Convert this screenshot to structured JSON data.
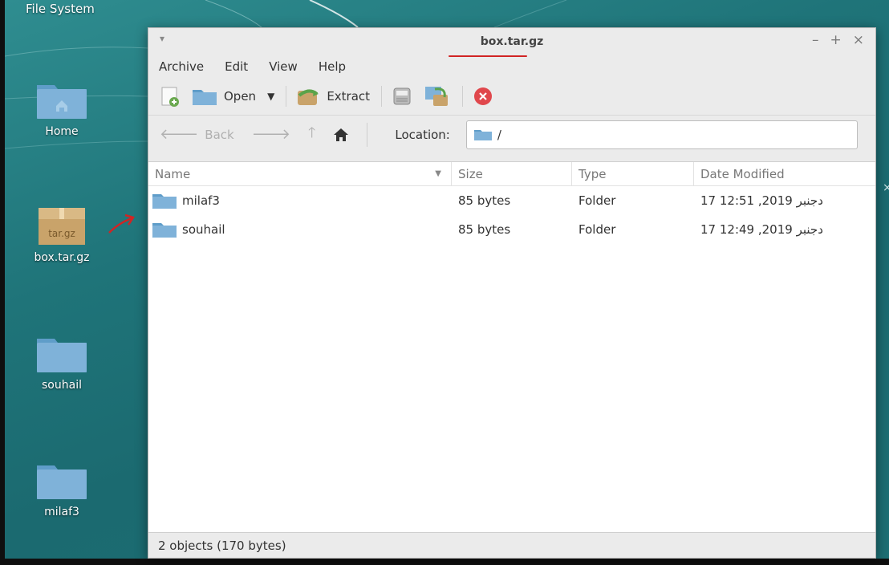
{
  "desktop": {
    "top_label": "File System",
    "icons": [
      {
        "label": "Home"
      },
      {
        "label": "box.tar.gz",
        "badge": "tar.gz"
      },
      {
        "label": "souhail"
      },
      {
        "label": "milaf3"
      }
    ],
    "stray_close": "×"
  },
  "window": {
    "menu_glyph": "▾",
    "title": "box.tar.gz",
    "controls": {
      "minimize": "–",
      "maximize": "+",
      "close": "×"
    },
    "menu": [
      "Archive",
      "Edit",
      "View",
      "Help"
    ],
    "toolbar": {
      "open_label": "Open",
      "extract_label": "Extract"
    },
    "nav": {
      "back_label": "Back",
      "location_label": "Location:",
      "location_value": "/"
    },
    "columns": {
      "name": "Name",
      "size": "Size",
      "type": "Type",
      "date": "Date Modified"
    },
    "rows": [
      {
        "name": "milaf3",
        "size": "85 bytes",
        "type": "Folder",
        "date": "17 دجنبر 2019, 12:51"
      },
      {
        "name": "souhail",
        "size": "85 bytes",
        "type": "Folder",
        "date": "17 دجنبر 2019, 12:49"
      }
    ],
    "status": "2 objects (170 bytes)"
  },
  "colors": {
    "desktop_teal": "#1f7479",
    "annotation_red": "#d12424",
    "folder_blue": "#7fb2d9",
    "stop_red": "#e0474c"
  }
}
